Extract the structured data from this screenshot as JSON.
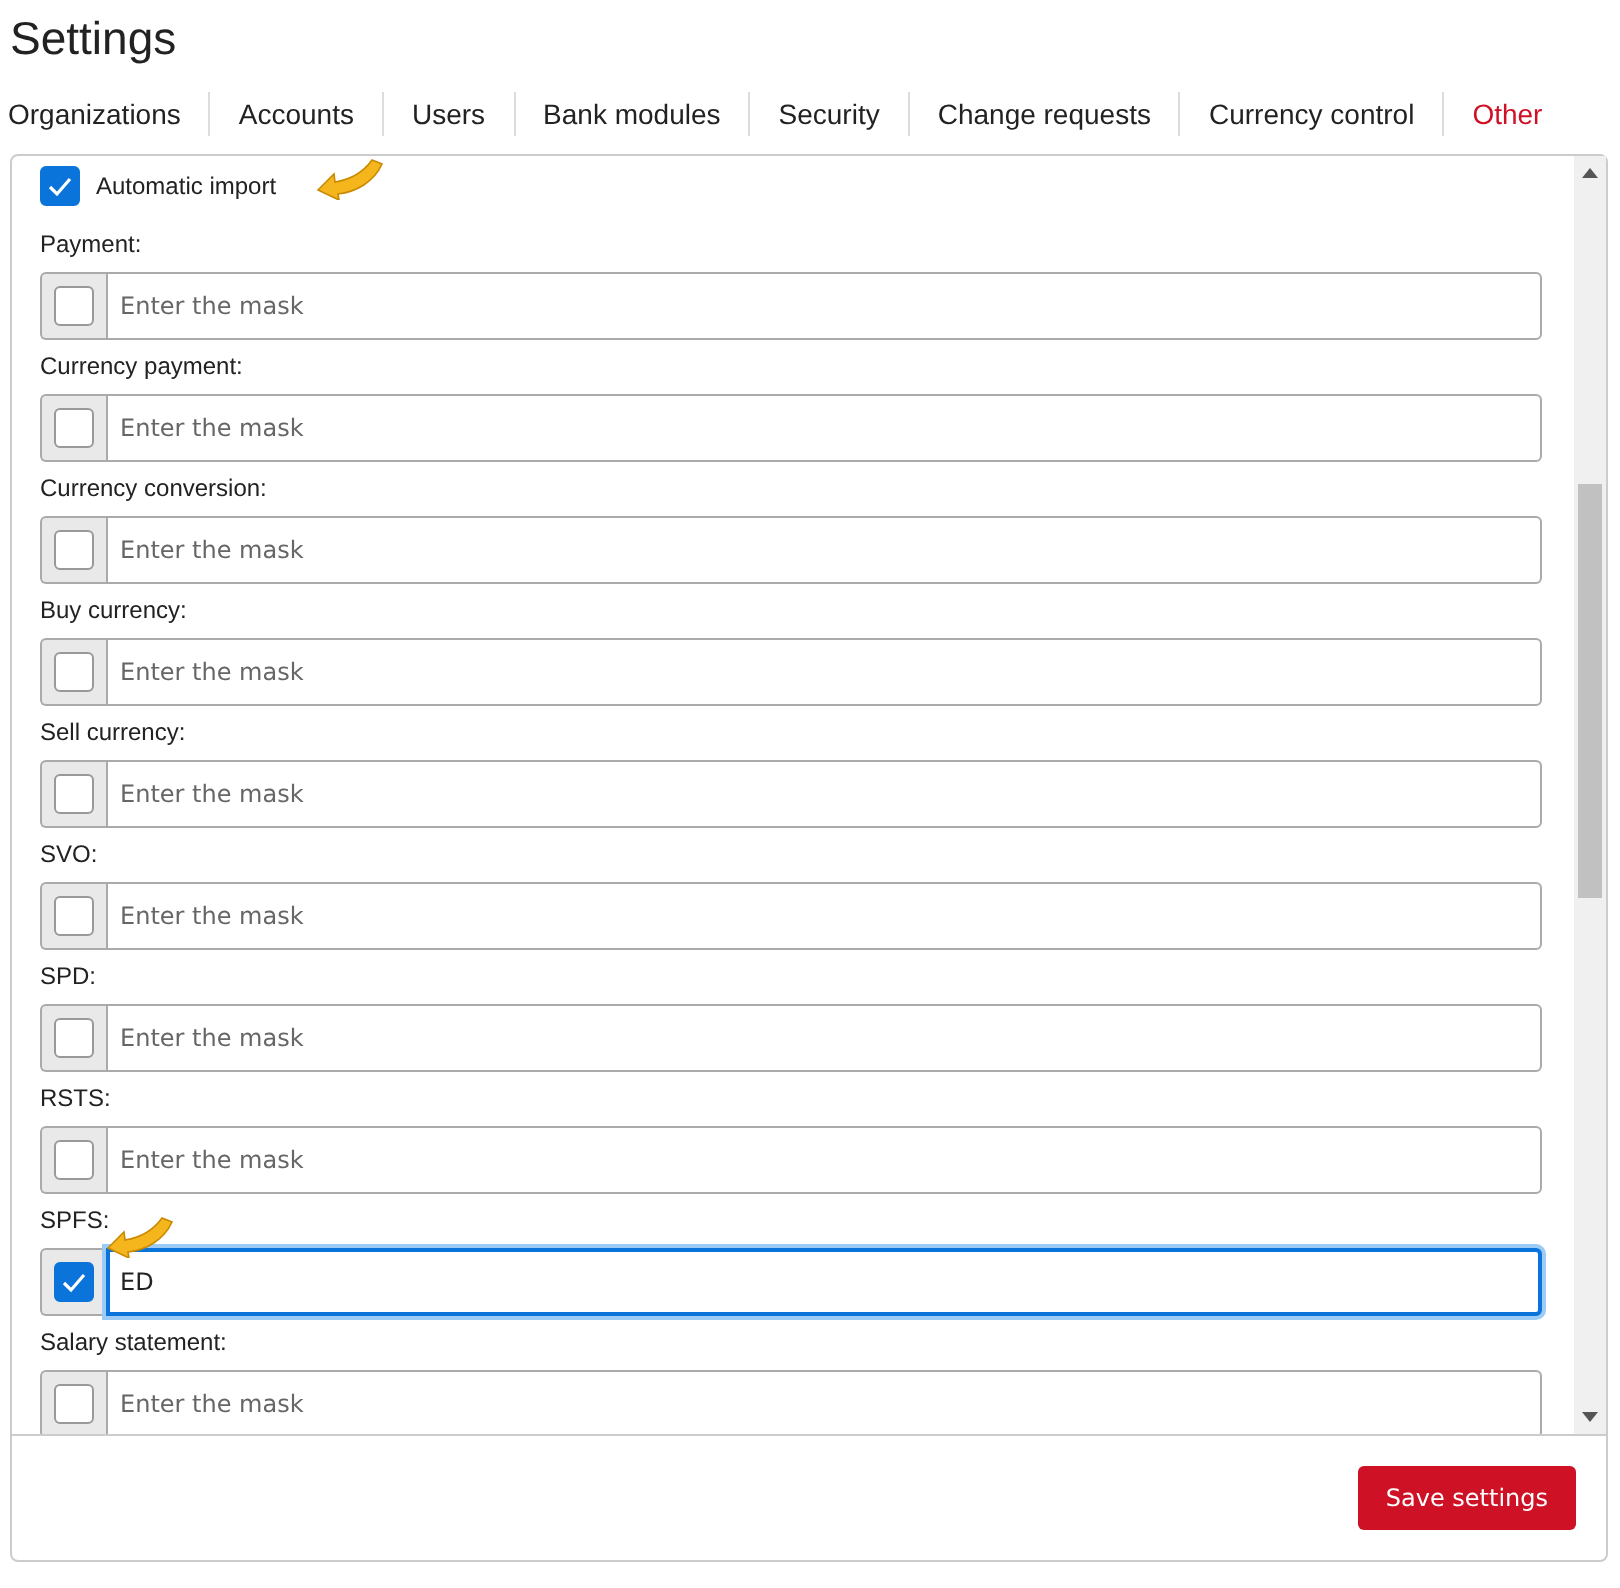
{
  "page": {
    "title": "Settings"
  },
  "tabs": [
    {
      "label": "Organizations",
      "selected": false
    },
    {
      "label": "Accounts",
      "selected": false
    },
    {
      "label": "Users",
      "selected": false
    },
    {
      "label": "Bank modules",
      "selected": false
    },
    {
      "label": "Security",
      "selected": false
    },
    {
      "label": "Change requests",
      "selected": false
    },
    {
      "label": "Currency control",
      "selected": false
    },
    {
      "label": "Other",
      "selected": true
    }
  ],
  "automatic_import": {
    "label": "Automatic import",
    "checked": true,
    "marked": true
  },
  "masks": [
    {
      "label": "Payment:",
      "checked": false,
      "placeholder": "Enter the mask",
      "marked": false
    },
    {
      "label": "Currency payment:",
      "checked": false,
      "placeholder": "Enter the mask",
      "marked": false
    },
    {
      "label": "Currency conversion:",
      "checked": false,
      "placeholder": "Enter the mask",
      "marked": false
    },
    {
      "label": "Buy currency:",
      "checked": false,
      "placeholder": "Enter the mask",
      "marked": false
    },
    {
      "label": "Sell currency:",
      "checked": false,
      "placeholder": "Enter the mask",
      "marked": false
    },
    {
      "label": "SVO:",
      "checked": false,
      "placeholder": "Enter the mask",
      "marked": false
    },
    {
      "label": "SPD:",
      "checked": false,
      "placeholder": "Enter the mask",
      "marked": false
    },
    {
      "label": "RSTS:",
      "checked": false,
      "placeholder": "Enter the mask",
      "marked": false
    },
    {
      "label": "SPFS:",
      "checked": true,
      "value": "ED",
      "focused": true,
      "marked": true
    },
    {
      "label": "Salary statement:",
      "checked": false,
      "placeholder": "Enter the mask",
      "marked": false
    }
  ],
  "save_button": "Save settings"
}
